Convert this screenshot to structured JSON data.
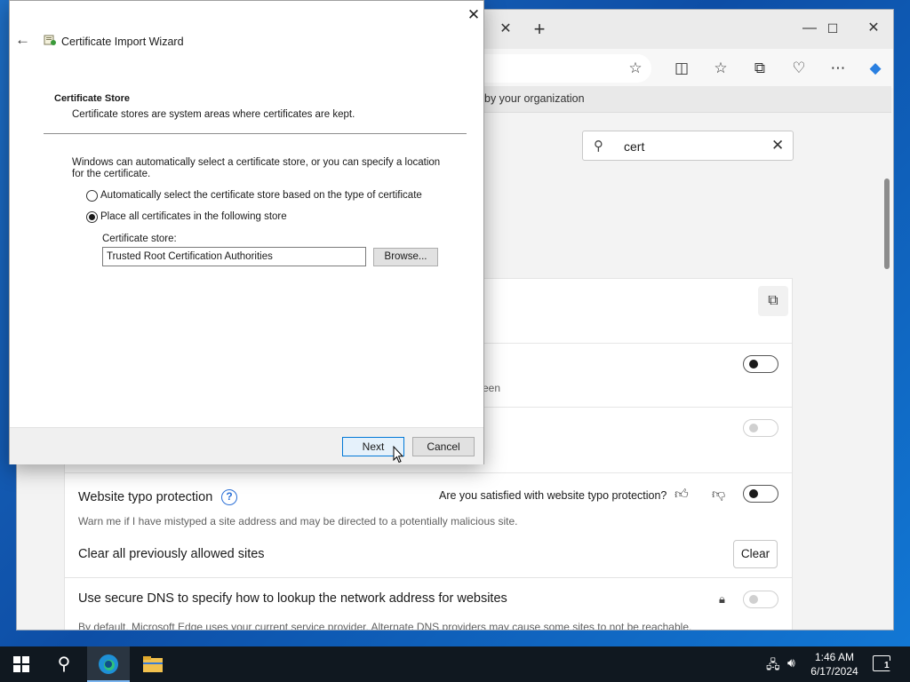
{
  "browser": {
    "infobar_text": "by your organization",
    "search": {
      "value": "cert"
    },
    "settings": {
      "partial_desc_1": "reen",
      "typo": {
        "title": "Website typo protection",
        "feedback_question": "Are you satisfied with website typo protection?",
        "desc": "Warn me if I have mistyped a site address and may be directed to a potentially malicious site."
      },
      "clear_allowed": {
        "title": "Clear all previously allowed sites",
        "button": "Clear"
      },
      "secure_dns": {
        "title": "Use secure DNS to specify how to lookup the network address for websites",
        "desc": "By default, Microsoft Edge uses your current service provider. Alternate DNS providers may cause some sites to not be reachable."
      }
    }
  },
  "wizard": {
    "title": "Certificate Import Wizard",
    "heading": "Certificate Store",
    "subheading": "Certificate stores are system areas where certificates are kept.",
    "intro": "Windows can automatically select a certificate store, or you can specify a location for the certificate.",
    "option_auto": "Automatically select the certificate store based on the type of certificate",
    "option_place": "Place all certificates in the following store",
    "store_label": "Certificate store:",
    "store_value": "Trusted Root Certification Authorities",
    "browse": "Browse...",
    "next": "Next",
    "cancel": "Cancel"
  },
  "taskbar": {
    "time": "1:46 AM",
    "date": "6/17/2024",
    "notifications": "1"
  },
  "colors": {
    "accent": "#0078d7",
    "help_icon": "#2a6fd6",
    "taskbar": "#101820"
  }
}
